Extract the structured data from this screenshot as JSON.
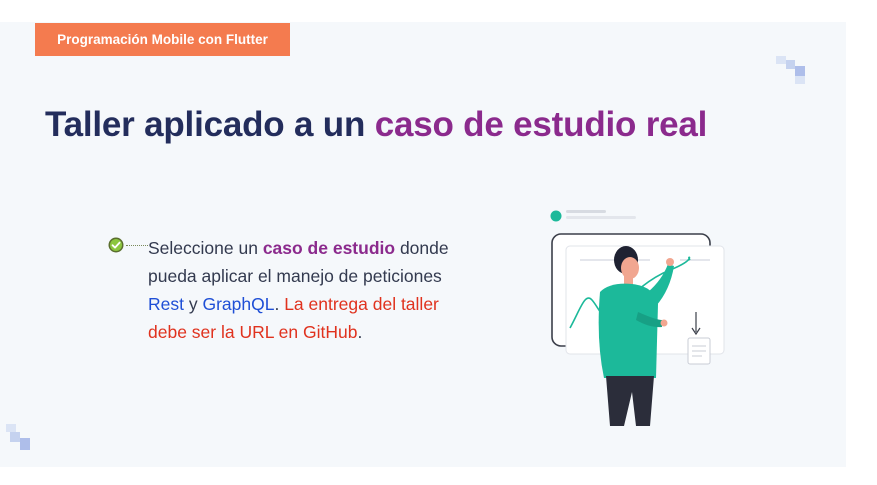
{
  "badge": "Programación Mobile con Flutter",
  "title": {
    "part1": "Taller aplicado a un ",
    "part2": "caso de estudio real"
  },
  "bullet": {
    "t1": "Seleccione un ",
    "t2": "caso de estudio",
    "t3": " donde pueda aplicar el manejo de peticiones ",
    "t4": "Rest",
    "t5": " y ",
    "t6": "GraphQL",
    "t7": ". ",
    "t8": "La entrega del taller debe ser la URL en GitHub",
    "t9": "."
  },
  "colors": {
    "badge": "#f47b4f",
    "navy": "#232d5c",
    "purple": "#8b2a8d",
    "blue": "#1f4fd6",
    "red": "#e0321e",
    "teal": "#1cb99a"
  },
  "icons": [
    "check-circle-icon",
    "presentation-illustration",
    "pixel-deco"
  ]
}
